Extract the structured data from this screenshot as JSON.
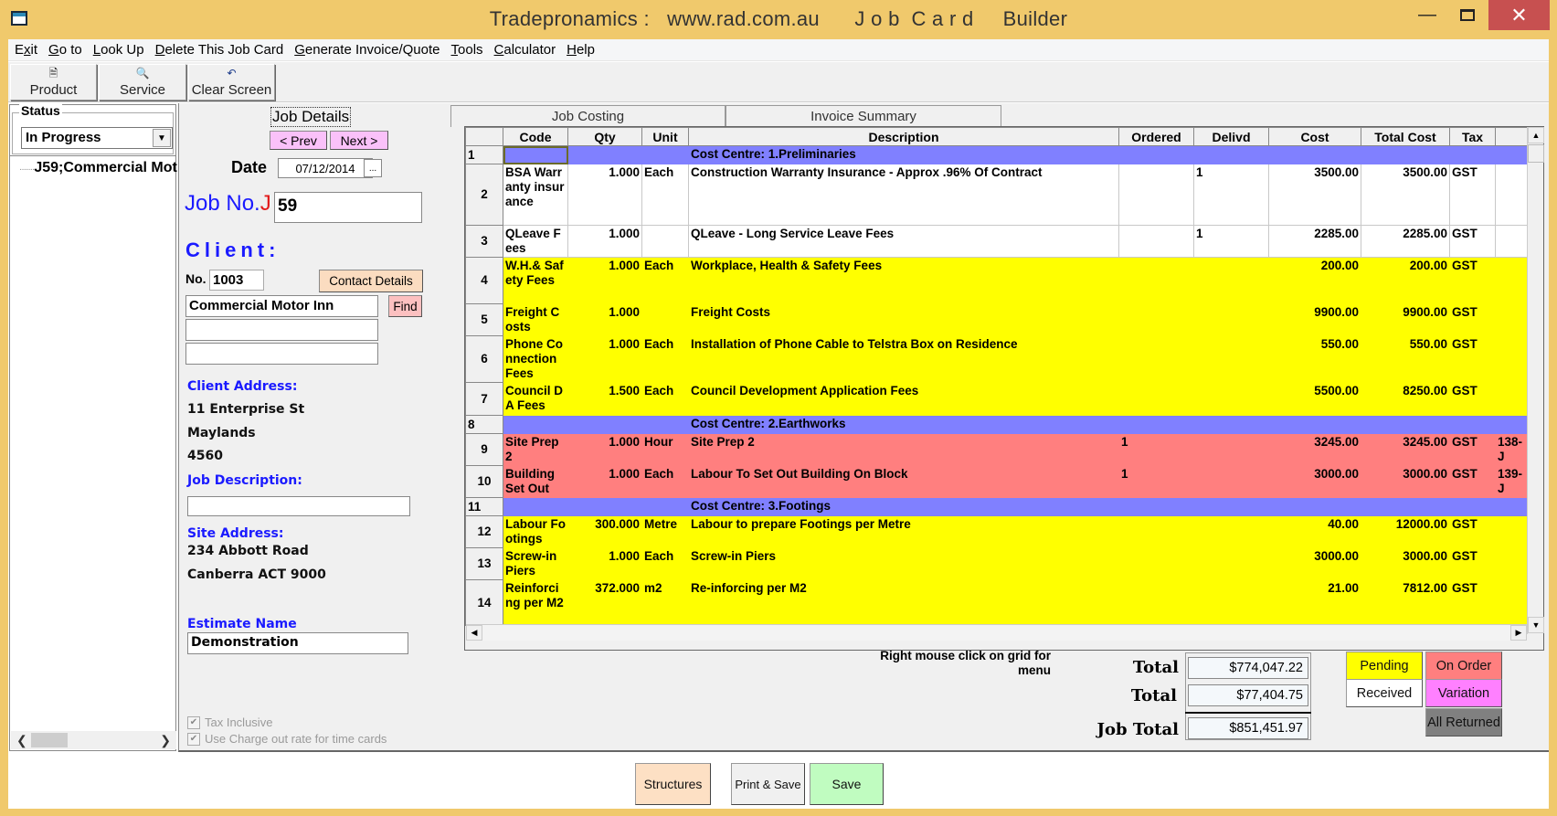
{
  "window": {
    "title": "Tradepronamics :   www.rad.com.au      J o b  C a r d     Builder",
    "minimize_icon": "minimize-icon",
    "maximize_icon": "maximize-icon",
    "close_icon": "close-icon"
  },
  "menu": [
    {
      "label": "Exit",
      "accel": "x"
    },
    {
      "label": "Go to",
      "accel": "G"
    },
    {
      "label": "Look Up",
      "accel": "L"
    },
    {
      "label": "Delete This Job Card",
      "accel": "D"
    },
    {
      "label": "Generate Invoice/Quote",
      "accel": "G"
    },
    {
      "label": "Tools",
      "accel": "T"
    },
    {
      "label": "Calculator",
      "accel": "C"
    },
    {
      "label": "Help",
      "accel": "H"
    }
  ],
  "toolbar": {
    "product": {
      "label": "Product",
      "icon": "document-icon"
    },
    "service": {
      "label": "Service",
      "icon": "document-search-icon"
    },
    "clear": {
      "label": "Clear Screen",
      "icon": "undo-icon"
    }
  },
  "left_panel": {
    "status_label": "Status",
    "status_value": "In Progress",
    "tree_item": "J59;Commercial Mot"
  },
  "job_details": {
    "tab_label": "Job Details",
    "prev_label": "< Prev",
    "next_label": "Next >",
    "date_label": "Date",
    "date_value": "07/12/2014",
    "date_button": "...",
    "job_no_label": "Job No.",
    "job_no_prefix": "J",
    "job_no_value": "59",
    "client_label": "Client:",
    "client_no_label": "No.",
    "client_no_value": "1003",
    "contact_details_label": "Contact Details",
    "client_name": "Commercial Motor Inn",
    "client_line2": "",
    "client_line3": "",
    "find_label": "Find",
    "client_address_label": "Client Address:",
    "client_address": [
      "11 Enterprise St",
      "Maylands",
      "4560"
    ],
    "job_description_label": "Job Description:",
    "job_description_value": "",
    "site_address_label": "Site Address:",
    "site_address": [
      "234 Abbott Road",
      "Canberra ACT 9000"
    ],
    "estimate_name_label": "Estimate Name",
    "estimate_name_value": "Demonstration",
    "tax_inclusive_label": "Tax Inclusive",
    "charge_out_label": "Use Charge out rate for time cards"
  },
  "tabs": {
    "job_costing": "Job Costing",
    "invoice_summary": "Invoice Summary"
  },
  "grid": {
    "columns": [
      "Code",
      "Qty",
      "Unit",
      "Description",
      "Ordered",
      "Delivd",
      "Cost",
      "Total Cost",
      "Tax",
      ""
    ],
    "rows": [
      {
        "n": "1",
        "type": "cc",
        "code": "",
        "qty": "",
        "unit": "",
        "desc": "Cost Centre:  1.Preliminaries",
        "ordered": "",
        "delivd": "",
        "cost": "",
        "total": "",
        "tax": "",
        "extra": ""
      },
      {
        "n": "2",
        "type": "white",
        "code": "BSA Warranty insurance",
        "qty": "1.000",
        "unit": "Each",
        "desc": "Construction Warranty Insurance -  Approx .96% Of Contract",
        "ordered": "",
        "delivd": "1",
        "cost": "3500.00",
        "total": "3500.00",
        "tax": "GST",
        "extra": ""
      },
      {
        "n": "3",
        "type": "white",
        "code": "QLeave Fees",
        "qty": "1.000",
        "unit": "",
        "desc": "QLeave - Long Service Leave Fees",
        "ordered": "",
        "delivd": "1",
        "cost": "2285.00",
        "total": "2285.00",
        "tax": "GST",
        "extra": ""
      },
      {
        "n": "4",
        "type": "yellow",
        "code": "W.H.& Safety Fees",
        "qty": "1.000",
        "unit": "Each",
        "desc": "Workplace, Health & Safety Fees",
        "ordered": "",
        "delivd": "",
        "cost": "200.00",
        "total": "200.00",
        "tax": "GST",
        "extra": ""
      },
      {
        "n": "5",
        "type": "yellow",
        "code": "Freight Costs",
        "qty": "1.000",
        "unit": "",
        "desc": "Freight Costs",
        "ordered": "",
        "delivd": "",
        "cost": "9900.00",
        "total": "9900.00",
        "tax": "GST",
        "extra": ""
      },
      {
        "n": "6",
        "type": "yellow",
        "code": "Phone Connection Fees",
        "qty": "1.000",
        "unit": "Each",
        "desc": "Installation of Phone Cable to Telstra Box on Residence",
        "ordered": "",
        "delivd": "",
        "cost": "550.00",
        "total": "550.00",
        "tax": "GST",
        "extra": ""
      },
      {
        "n": "7",
        "type": "yellow",
        "code": "Council DA Fees",
        "qty": "1.500",
        "unit": "Each",
        "desc": "Council Development Application Fees",
        "ordered": "",
        "delivd": "",
        "cost": "5500.00",
        "total": "8250.00",
        "tax": "GST",
        "extra": ""
      },
      {
        "n": "8",
        "type": "cc",
        "code": "",
        "qty": "",
        "unit": "",
        "desc": "Cost Centre:  2.Earthworks",
        "ordered": "",
        "delivd": "",
        "cost": "",
        "total": "",
        "tax": "",
        "extra": ""
      },
      {
        "n": "9",
        "type": "red",
        "code": "Site Prep2",
        "qty": "1.000",
        "unit": "Hour",
        "desc": "Site Prep 2",
        "ordered": "1",
        "delivd": "",
        "cost": "3245.00",
        "total": "3245.00",
        "tax": "GST",
        "extra": "138-J"
      },
      {
        "n": "10",
        "type": "red",
        "code": "Building Set Out",
        "qty": "1.000",
        "unit": "Each",
        "desc": "Labour To Set Out Building On Block",
        "ordered": "1",
        "delivd": "",
        "cost": "3000.00",
        "total": "3000.00",
        "tax": "GST",
        "extra": "139-J"
      },
      {
        "n": "11",
        "type": "cc",
        "code": "",
        "qty": "",
        "unit": "",
        "desc": "Cost Centre:  3.Footings",
        "ordered": "",
        "delivd": "",
        "cost": "",
        "total": "",
        "tax": "",
        "extra": ""
      },
      {
        "n": "12",
        "type": "yellow",
        "code": "Labour Footings",
        "qty": "300.000",
        "unit": "Metre",
        "desc": "Labour to prepare Footings per Metre",
        "ordered": "",
        "delivd": "",
        "cost": "40.00",
        "total": "12000.00",
        "tax": "GST",
        "extra": ""
      },
      {
        "n": "13",
        "type": "yellow",
        "code": "Screw-in Piers",
        "qty": "1.000",
        "unit": "Each",
        "desc": "Screw-in Piers",
        "ordered": "",
        "delivd": "",
        "cost": "3000.00",
        "total": "3000.00",
        "tax": "GST",
        "extra": ""
      },
      {
        "n": "14",
        "type": "yellow",
        "code": "Reinforcing per M2",
        "qty": "372.000",
        "unit": "m2",
        "desc": "Re-inforcing per M2",
        "ordered": "",
        "delivd": "",
        "cost": "21.00",
        "total": "7812.00",
        "tax": "GST",
        "extra": ""
      }
    ]
  },
  "footer": {
    "hint": "Right mouse click on grid for menu",
    "total1_label": "Total",
    "total1_value": "$774,047.22",
    "total2_label": "Total",
    "total2_value": "$77,404.75",
    "job_total_label": "Job Total",
    "job_total_value": "$851,451.97"
  },
  "legend": {
    "pending": {
      "label": "Pending",
      "color": "#ffff00"
    },
    "on_order": {
      "label": "On Order",
      "color": "#ff7f7f"
    },
    "received": {
      "label": "Received",
      "color": "#ffffff"
    },
    "variation": {
      "label": "Variation",
      "color": "#ff80ff"
    },
    "all_returned": {
      "label": "All Returned",
      "color": "#808080"
    }
  },
  "bottom_buttons": {
    "structures": "Structures",
    "print_save": "Print & Save",
    "save": "Save"
  },
  "colors": {
    "cost_centre": "#8080ff",
    "pending": "#ffff00",
    "on_order": "#ff7f7f",
    "titlebar": "#f0c96c",
    "close": "#c75050"
  }
}
